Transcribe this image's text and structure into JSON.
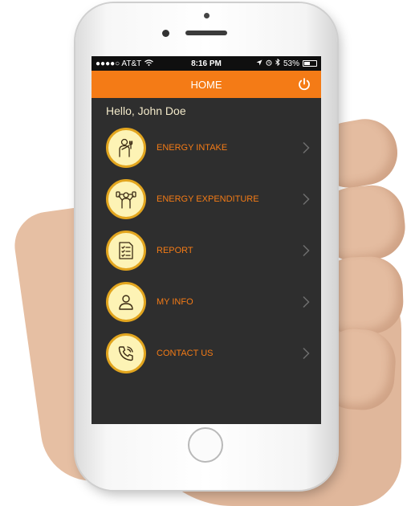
{
  "status_bar": {
    "carrier": "●●●●○ AT&T",
    "time": "8:16 PM",
    "battery": "53%",
    "battery_level": 0.53
  },
  "navbar": {
    "title": "HOME",
    "power_icon": "power-icon"
  },
  "greeting": "Hello,  John Doe",
  "menu": [
    {
      "label": "ENERGY INTAKE",
      "icon": "person-eating-icon"
    },
    {
      "label": "ENERGY EXPENDITURE",
      "icon": "weightlifter-icon"
    },
    {
      "label": "REPORT",
      "icon": "report-icon"
    },
    {
      "label": "MY INFO",
      "icon": "user-icon"
    },
    {
      "label": "CONTACT US",
      "icon": "phone-icon"
    }
  ],
  "colors": {
    "accent": "#f47b16",
    "screen_bg": "#2e2e2e",
    "icon_bg": "#fdf3b5",
    "icon_border": "#e2a51e"
  }
}
